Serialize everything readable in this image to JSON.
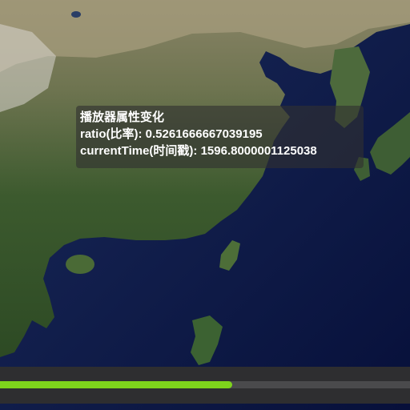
{
  "map_view": {
    "imagery": "satellite",
    "region": "East Asia"
  },
  "info_panel": {
    "title": "播放器属性变化",
    "ratio_line": "ratio(比率): 0.5261666667039195",
    "current_time_line": "currentTime(时间戳): 1596.8000001125038"
  },
  "player": {
    "progress_ratio": 0.5261666667039195,
    "progress_color": "#7ed31c",
    "track_color": "#4a4a4c",
    "bar_color": "#2e2e30"
  }
}
